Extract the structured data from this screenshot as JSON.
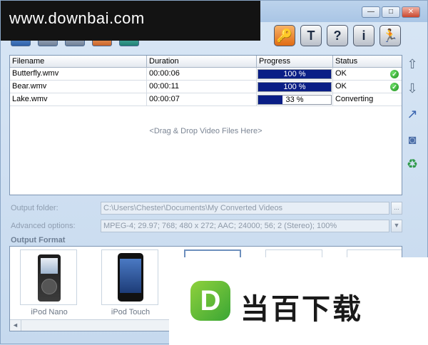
{
  "watermark": "www.downbai.com",
  "window_controls": {
    "minimize": "—",
    "maximize": "□",
    "close": "✕"
  },
  "toolbar": {
    "buttons": [
      {
        "name": "key",
        "glyph": "🔑"
      },
      {
        "name": "t",
        "glyph": "T"
      },
      {
        "name": "help",
        "glyph": "?"
      },
      {
        "name": "info",
        "glyph": "i"
      },
      {
        "name": "exit",
        "glyph": "🏃"
      }
    ]
  },
  "grid": {
    "columns": [
      "Filename",
      "Duration",
      "Progress",
      "Status"
    ],
    "rows": [
      {
        "filename": "Butterfly.wmv",
        "duration": "00:00:06",
        "progress": 100,
        "progress_text": "100 %",
        "status": "OK",
        "ok": true
      },
      {
        "filename": "Bear.wmv",
        "duration": "00:00:11",
        "progress": 100,
        "progress_text": "100 %",
        "status": "OK",
        "ok": true
      },
      {
        "filename": "Lake.wmv",
        "duration": "00:00:07",
        "progress": 33,
        "progress_text": "33 %",
        "status": "Converting",
        "ok": false
      }
    ],
    "drop_hint": "<Drag & Drop Video Files Here>"
  },
  "side_buttons": [
    {
      "name": "move-up",
      "glyph": "⇧"
    },
    {
      "name": "move-down",
      "glyph": "⇩"
    },
    {
      "name": "export",
      "glyph": "↗"
    },
    {
      "name": "camera",
      "glyph": "◙"
    },
    {
      "name": "recycle",
      "glyph": "♻"
    }
  ],
  "output_folder": {
    "label": "Output folder:",
    "value": "C:\\Users\\Chester\\Documents\\My Converted Videos",
    "button": "..."
  },
  "advanced_options": {
    "label": "Advanced options:",
    "value": "MPEG-4; 29.97; 768; 480 x 272; AAC; 24000; 56; 2 (Stereo); 100%",
    "button": "▼"
  },
  "output_format": {
    "label": "Output Format",
    "tiles": [
      {
        "label": "iPod Nano"
      },
      {
        "label": "iPod Touch"
      }
    ]
  },
  "scroll_left": "◄",
  "brand_logo": {
    "mark": "D",
    "text": "当百下载"
  }
}
